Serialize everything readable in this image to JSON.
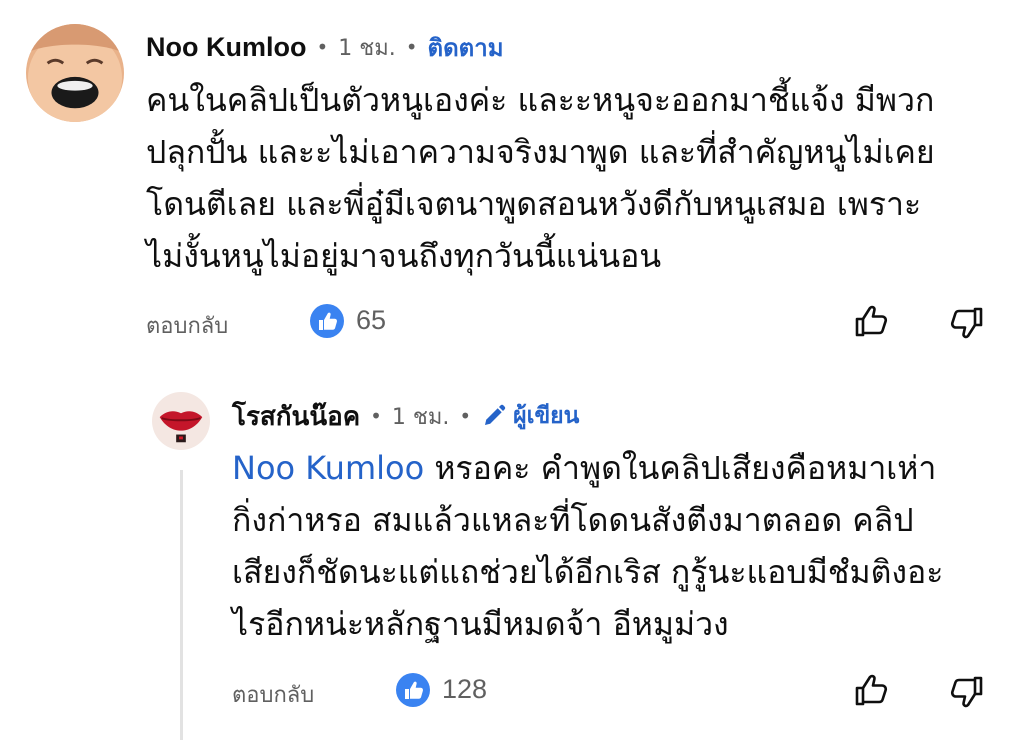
{
  "comment": {
    "author": "Noo Kumloo",
    "time": "1 ชม.",
    "separator": "•",
    "follow_label": "ติดตาม",
    "text_lines": [
      "คนในคลิปเป็นตัวหนูเองค่ะ และะหนูจะออกมาชี้แจ้ง มีพวก",
      "ปลุกปั้น และะไม่เอาความจริงมาพูด และที่สำคัญหนูไม่เคย",
      "โดนตีเลย และพี่อู๋มีเจตนาพูดสอนหวังดีกับหนูเสมอ เพราะ",
      "ไม่งั้นหนูไม่อยู่มาจนถึงทุกวันนี้แน่นอน"
    ],
    "reply_label": "ตอบกลับ",
    "like_count": "65",
    "avatar_icon": "avatar-laughing-face",
    "like_badge_icon": "thumbs-up-filled-icon",
    "like_icon": "thumbs-up-outline-icon",
    "dislike_icon": "thumbs-down-outline-icon"
  },
  "reply": {
    "author": "โรสกันน๊อค",
    "time": "1 ชม.",
    "separator": "•",
    "creator_label": "ผู้เขียน",
    "creator_icon": "pen-icon",
    "mention": "Noo Kumloo",
    "text_first_rest": " หรอคะ คำพูดในคลิปเสียงคือหมาเห่า",
    "text_lines": [
      "กิ่งก่าหรอ สมแล้วแหละที่โดดนสังตีงมาตลอด คลิป",
      "เสียงก็ชัดนะแต่แถช่วยได้อีกเริส กูรู้นะแอบมีชํมติงอะ",
      "ไรอีกหน่ะหลักฐานมีหมดจ้า อีหมูม่วง"
    ],
    "reply_label": "ตอบกลับ",
    "like_count": "128",
    "avatar_icon": "avatar-red-lips",
    "like_badge_icon": "thumbs-up-filled-icon",
    "like_icon": "thumbs-up-outline-icon",
    "dislike_icon": "thumbs-down-outline-icon"
  },
  "colors": {
    "link_blue": "#2563c9",
    "like_badge_blue": "#3a83f1",
    "meta_gray": "#606060",
    "text": "#0f0f0f"
  }
}
